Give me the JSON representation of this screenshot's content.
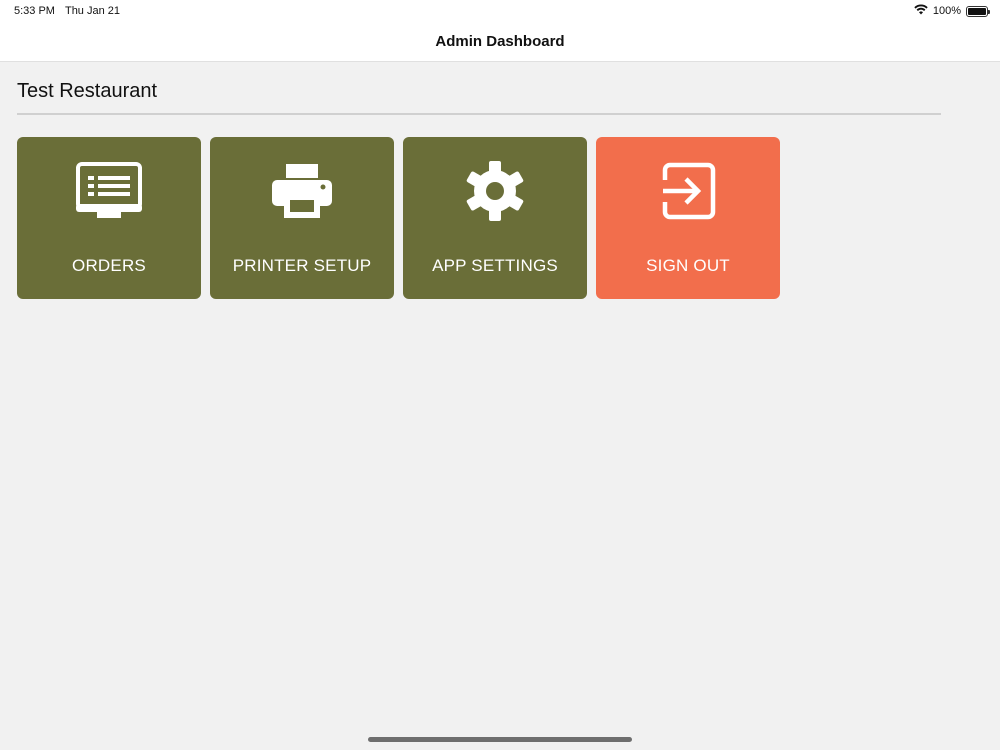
{
  "status_bar": {
    "time": "5:33 PM",
    "date": "Thu Jan 21",
    "battery_text": "100%",
    "battery_level": 1.0,
    "icons": [
      "wifi-icon",
      "battery-icon"
    ]
  },
  "nav": {
    "title": "Admin Dashboard"
  },
  "restaurant": {
    "name": "Test Restaurant"
  },
  "tiles": [
    {
      "label": "ORDERS",
      "icon": "monitor-list-icon",
      "color": "#6a6e38"
    },
    {
      "label": "PRINTER SETUP",
      "icon": "printer-icon",
      "color": "#6a6e38"
    },
    {
      "label": "APP SETTINGS",
      "icon": "gear-icon",
      "color": "#6a6e38"
    },
    {
      "label": "SIGN OUT",
      "icon": "sign-out-icon",
      "color": "#f26e4c"
    }
  ],
  "colors": {
    "tile_primary": "#6a6e38",
    "tile_signout": "#f26e4c",
    "background": "#f1f1f1"
  }
}
